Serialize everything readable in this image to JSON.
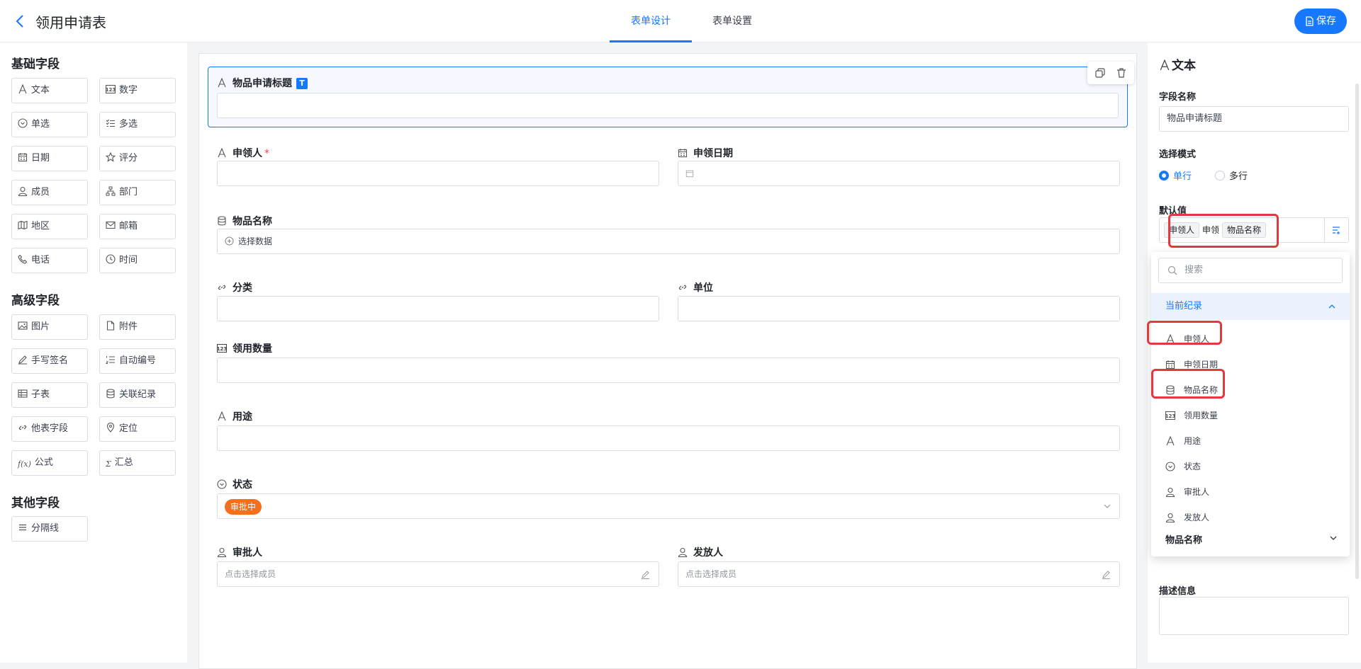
{
  "header": {
    "title": "领用申请表",
    "tabs": [
      "表单设计",
      "表单设置"
    ],
    "save_label": "保存"
  },
  "palette": {
    "basic_title": "基础字段",
    "basic": [
      {
        "label": "文本",
        "icon": "text-icon"
      },
      {
        "label": "数字",
        "icon": "number-icon"
      },
      {
        "label": "单选",
        "icon": "single-select-icon"
      },
      {
        "label": "多选",
        "icon": "multi-select-icon"
      },
      {
        "label": "日期",
        "icon": "calendar-icon"
      },
      {
        "label": "评分",
        "icon": "star-icon"
      },
      {
        "label": "成员",
        "icon": "user-icon"
      },
      {
        "label": "部门",
        "icon": "org-icon"
      },
      {
        "label": "地区",
        "icon": "map-icon"
      },
      {
        "label": "邮箱",
        "icon": "mail-icon"
      },
      {
        "label": "电话",
        "icon": "phone-icon"
      },
      {
        "label": "时间",
        "icon": "clock-icon"
      }
    ],
    "advanced_title": "高级字段",
    "advanced": [
      {
        "label": "图片",
        "icon": "image-icon"
      },
      {
        "label": "附件",
        "icon": "file-icon"
      },
      {
        "label": "手写签名",
        "icon": "pen-icon"
      },
      {
        "label": "自动编号",
        "icon": "numbered-list-icon"
      },
      {
        "label": "子表",
        "icon": "table-icon"
      },
      {
        "label": "关联纪录",
        "icon": "database-icon"
      },
      {
        "label": "他表字段",
        "icon": "link-icon"
      },
      {
        "label": "定位",
        "icon": "location-icon"
      },
      {
        "label": "公式",
        "icon": "formula-icon",
        "glyph": "f(x)"
      },
      {
        "label": "汇总",
        "icon": "sum-icon",
        "glyph": "Σ"
      }
    ],
    "other_title": "其他字段",
    "other": [
      {
        "label": "分隔线",
        "icon": "divider-icon"
      }
    ]
  },
  "form": {
    "title_field": {
      "label": "物品申请标题",
      "badge": "T"
    },
    "applicant": {
      "label": "申领人",
      "required_mark": "*"
    },
    "apply_date": {
      "label": "申领日期"
    },
    "item_name": {
      "label": "物品名称",
      "placeholder": "选择数据"
    },
    "category": {
      "label": "分类"
    },
    "unit": {
      "label": "单位"
    },
    "quantity": {
      "label": "领用数量"
    },
    "purpose": {
      "label": "用途"
    },
    "status": {
      "label": "状态",
      "value": "审批中"
    },
    "approver": {
      "label": "审批人",
      "placeholder": "点击选择成员"
    },
    "issuer": {
      "label": "发放人",
      "placeholder": "点击选择成员"
    }
  },
  "props": {
    "type_title": "文本",
    "field_name_label": "字段名称",
    "field_name_value": "物品申请标题",
    "mode_label": "选择模式",
    "mode_options": [
      "单行",
      "多行"
    ],
    "mode_selected": "单行",
    "default_label": "默认值",
    "default_tokens": [
      "申领人",
      "申领",
      "物品名称"
    ],
    "desc_label": "描述信息"
  },
  "dropdown": {
    "search_placeholder": "搜索",
    "section": "当前纪录",
    "items": [
      {
        "label": "申领人",
        "icon": "text-icon"
      },
      {
        "label": "申领日期",
        "icon": "calendar-icon"
      },
      {
        "label": "物品名称",
        "icon": "database-icon"
      },
      {
        "label": "领用数量",
        "icon": "number-icon"
      },
      {
        "label": "用途",
        "icon": "text-icon"
      },
      {
        "label": "状态",
        "icon": "single-select-icon"
      },
      {
        "label": "审批人",
        "icon": "user-icon"
      },
      {
        "label": "发放人",
        "icon": "user-icon"
      }
    ],
    "footer": "物品名称"
  },
  "colors": {
    "accent": "#1677ff",
    "status_pill": "#f56f1b",
    "highlight": "#e4393c"
  }
}
